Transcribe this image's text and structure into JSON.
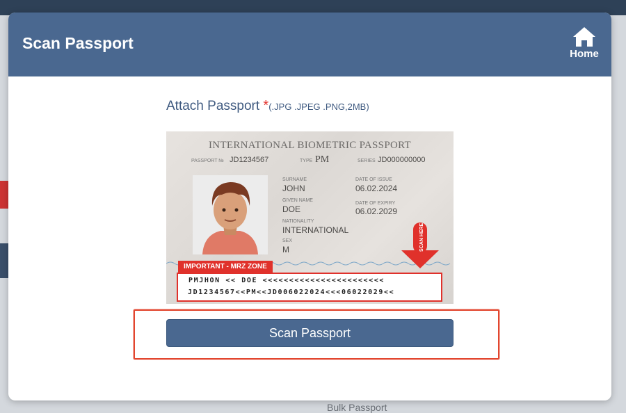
{
  "modal": {
    "title": "Scan Passport",
    "home_label": "Home",
    "attach_label": "Attach Passport ",
    "required_mark": "*",
    "formats": "(.JPG .JPEG .PNG,2MB)",
    "scan_button_label": "Scan Passport"
  },
  "passport_sample": {
    "title": "INTERNATIONAL BIOMETRIC PASSPORT",
    "passport_no_label": "PASSPORT №",
    "passport_no": "JD1234567",
    "type_label": "TYPE",
    "type": "PM",
    "series_label": "SERIES",
    "series": "JD000000000",
    "surname_label": "SURNAME",
    "surname": "JOHN",
    "given_name_label": "GIVEN NAME",
    "given_name": "DOE",
    "nationality_label": "NATIONALITY",
    "nationality": "INTERNATIONAL",
    "sex_label": "SEX",
    "sex": "M",
    "date_of_issue_label": "DATE OF ISSUE",
    "date_of_issue": "06.02.2024",
    "date_of_expiry_label": "DATE OF EXPIRY",
    "date_of_expiry": "06.02.2029",
    "scan_here": "SCAN HERE",
    "mrz_tag": "IMPORTANT - MRZ ZONE",
    "mrz_line1": "PMJHON << DOE <<<<<<<<<<<<<<<<<<<<<<<",
    "mrz_line2": "JD1234567<<PM<<JD006022024<<<06022029<<"
  },
  "colors": {
    "header": "#4a6890",
    "button": "#4a6890",
    "accent_red": "#e0312b",
    "highlight_red": "#e2462f"
  },
  "icons": {
    "home": "home-icon",
    "scan_arrow": "arrow-down-icon"
  },
  "background": {
    "partial_text": "Bulk Passport"
  }
}
